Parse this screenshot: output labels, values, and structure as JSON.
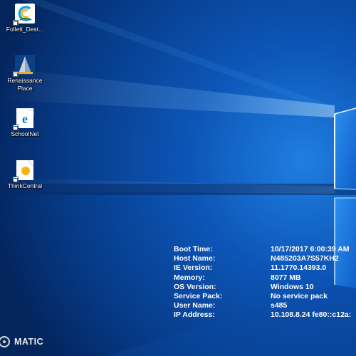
{
  "desktop": {
    "icons": [
      {
        "label": "Follett_Dest..."
      },
      {
        "label": "Renaissance Place"
      },
      {
        "label": "SchoolNet"
      },
      {
        "label": "ThinkCentral"
      }
    ]
  },
  "sysinfo": [
    {
      "label": "Boot Time:",
      "value": "10/17/2017 6:00:39 AM"
    },
    {
      "label": "Host Name:",
      "value": "N485203A7S57KH2"
    },
    {
      "label": "IE Version:",
      "value": "11.1770.14393.0"
    },
    {
      "label": "Memory:",
      "value": "8077 MB"
    },
    {
      "label": "OS Version:",
      "value": "Windows 10"
    },
    {
      "label": "Service Pack:",
      "value": "No service pack"
    },
    {
      "label": "User Name:",
      "value": "s485"
    },
    {
      "label": "IP Address:",
      "value": "10.108.8.24 fe80::c12a:"
    }
  ],
  "branding": {
    "logo_text": "MATIC"
  },
  "colors": {
    "wallpaper_dark": "#041a45",
    "wallpaper_mid": "#0a4aa0",
    "wallpaper_light": "#3aa0f0",
    "text": "#ffffff"
  }
}
